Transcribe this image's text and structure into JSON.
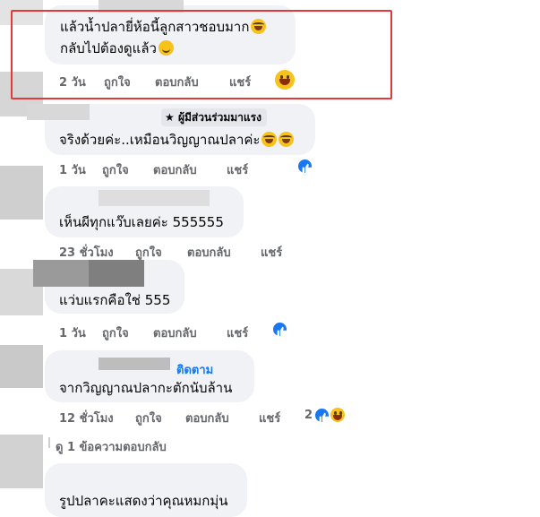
{
  "comments": [
    {
      "text_line1": "แล้วน้ำปลายี่ห้อนี้ลูกสาวชอบมาก",
      "text_line2": "กลับไปต้องดูแล้ว",
      "time": "2 วัน",
      "like": "ถูกใจ",
      "reply": "ตอบกลับ",
      "share": "แชร์",
      "reaction_icon": "laughing-face-emoji"
    },
    {
      "badge": "ผู้มีส่วนร่วมมาแรง",
      "text": "จริงด้วยค่ะ..เหมือนวิญญาณปลาค่ะ",
      "time": "1 วัน",
      "like": "ถูกใจ",
      "reply": "ตอบกลับ",
      "share": "แชร์",
      "reaction_icon": "like-icon"
    },
    {
      "text": "เห็นผีทุกแว๊บเลยค่ะ 555555",
      "time": "23 ชั่วโมง",
      "like": "ถูกใจ",
      "reply": "ตอบกลับ",
      "share": "แชร์"
    },
    {
      "text": "แว่บแรกคือใช่ 555",
      "time": "1 วัน",
      "like": "ถูกใจ",
      "reply": "ตอบกลับ",
      "share": "แชร์",
      "reaction_icon": "like-icon"
    },
    {
      "follow": "ติดตาม",
      "text": "จากวิญญาณปลากะตักนับล้าน",
      "time": "12 ชั่วโมง",
      "like": "ถูกใจ",
      "reply": "ตอบกลับ",
      "share": "แชร์",
      "reaction_count": "2"
    },
    {
      "text": "รูปปลาคะแสดงว่าคุณหมกมุ่น"
    }
  ],
  "view_replies": "ดู 1 ข้อความตอบกลับ",
  "colors": {
    "bubble": "#f0f2f5",
    "meta": "#65676b",
    "link": "#1877f2",
    "highlight": "#e03a3a"
  }
}
